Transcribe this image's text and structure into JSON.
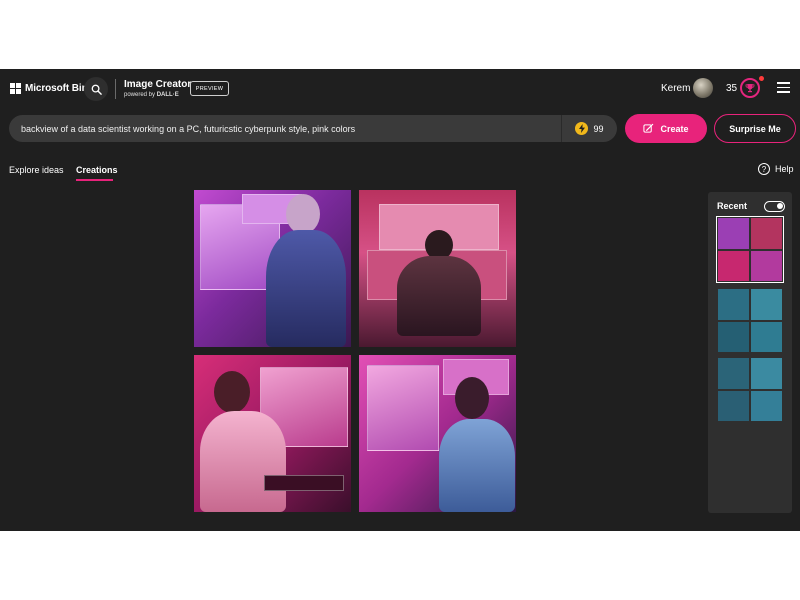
{
  "header": {
    "logo_label": "Microsoft Bing",
    "app_title": "Image Creator",
    "powered_by": "powered by",
    "powered_by_brand": "DALL·E",
    "preview_badge": "PREVIEW",
    "user_name": "Kerem",
    "coins": "35"
  },
  "prompt": {
    "value": "backview of a data scientist working on a PC, futuricstic cyberpunk style, pink colors",
    "boosts": "99",
    "create_label": "Create",
    "surprise_label": "Surprise Me"
  },
  "tabs": [
    {
      "label": "Explore ideas",
      "active": false
    },
    {
      "label": "Creations",
      "active": true
    }
  ],
  "help_label": "Help",
  "recent": {
    "title": "Recent",
    "toggle_on": true,
    "thumbnails": [
      {
        "theme": "pink",
        "colors": [
          "#9b3fb4",
          "#b3345f",
          "#c7286f",
          "#b23a9e"
        ],
        "selected": true
      },
      {
        "theme": "teal",
        "colors": [
          "#2c6e84",
          "#3a8ba0",
          "#255f73",
          "#2f7c92"
        ],
        "selected": false
      },
      {
        "theme": "teal",
        "colors": [
          "#2b6478",
          "#3b8aa1",
          "#2a5f74",
          "#347f98"
        ],
        "selected": false
      }
    ]
  },
  "colors": {
    "accent": "#e8237b",
    "background": "#1f1f1f",
    "panel": "#2f2f2f",
    "boost_coin": "#f1b81b"
  },
  "icons": {
    "search": "search-icon",
    "boost": "lightning-bolt-icon",
    "create": "pencil-sparkle-icon",
    "help": "question-circle-icon",
    "rewards": "trophy-icon",
    "menu": "hamburger-menu-icon"
  }
}
